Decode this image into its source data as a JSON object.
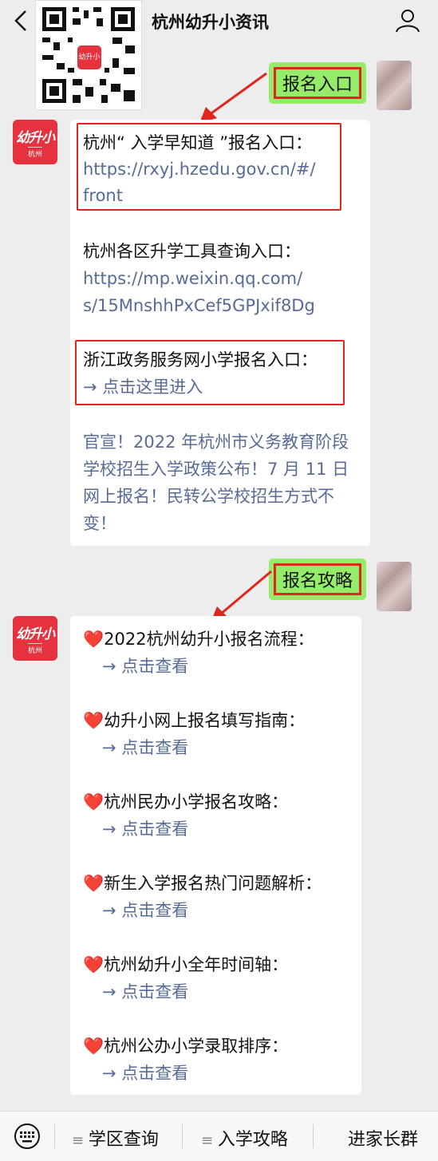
{
  "header": {
    "title": "杭州幼升小资讯",
    "qr_badge": "幼升小"
  },
  "msg1": {
    "keyword": "报名入口"
  },
  "logo": {
    "line1": "幼升小",
    "line2": "杭州"
  },
  "reply1": {
    "item1_title": "杭州“ 入学早知道 ”报名入口：",
    "item1_link_a": "https://rxyj.hzedu.gov.cn/#/",
    "item1_link_b": "front",
    "item2_title": "杭州各区升学工具查询入口：",
    "item2_link_a": "https://mp.weixin.qq.com/",
    "item2_link_b": "s/15MnshhPxCef5GPJxif8Dg",
    "item3_title": "浙江政务服务网小学报名入口：",
    "item3_link": "→ 点击这里进入",
    "news_1": "官宣！2022 年杭州市义务教育阶段",
    "news_2": "学校招生入学政策公布！7 月 11 日",
    "news_3": "网上报名！民转公学校招生方式不",
    "news_4": "变！"
  },
  "msg2": {
    "keyword": "报名攻略"
  },
  "reply2": {
    "heart": "❤️",
    "arrow_link": "→ 点击查看",
    "items": [
      "2022杭州幼升小报名流程：",
      "幼升小网上报名填写指南：",
      "杭州民办小学报名攻略：",
      "新生入学报名热门问题解析：",
      "杭州幼升小全年时间轴：",
      "杭州公办小学录取排序："
    ]
  },
  "bottom_menu": {
    "item1": "学区查询",
    "item2": "入学攻略",
    "item3": "进家长群"
  },
  "colors": {
    "bubble_green": "#95ec69",
    "highlight_red": "#e0261c",
    "link_blue": "#576b95",
    "brand_red": "#e5323e"
  },
  "icons": [
    "back-arrow-icon",
    "qr-code-icon",
    "person-icon",
    "keyboard-icon",
    "menu-icon",
    "heart-icon"
  ]
}
